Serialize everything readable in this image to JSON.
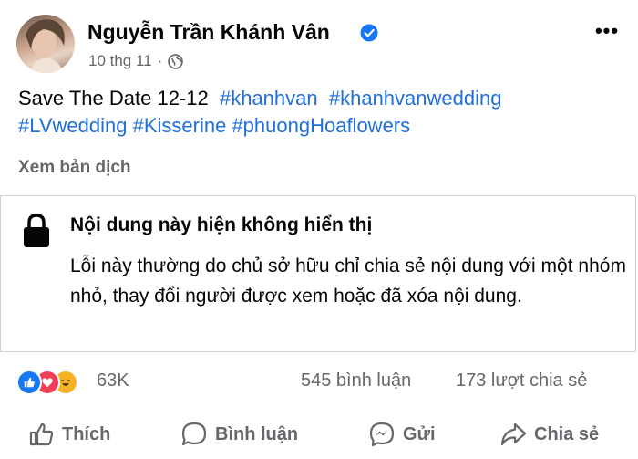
{
  "post": {
    "author": "Nguyễn Trần Khánh Vân",
    "date": "10 thg 11",
    "separator": "·",
    "more_label": "•••",
    "text_plain": "Save The Date 12-12",
    "hashtags": [
      "#khanhvan",
      "#khanhvanwedding",
      "#LVwedding",
      "#Kisserine",
      "#phuongHoaflowers"
    ],
    "translate_label": "Xem bản dịch"
  },
  "unavailable": {
    "title": "Nội dung này hiện không hiển thị",
    "body": "Lỗi này thường do chủ sở hữu chỉ chia sẻ nội dung với một nhóm nhỏ, thay đổi người được xem hoặc đã xóa nội dung."
  },
  "stats": {
    "reactions_count": "63K",
    "comments": "545 bình luận",
    "shares": "173 lượt chia sẻ"
  },
  "actions": {
    "like": "Thích",
    "comment": "Bình luận",
    "send": "Gửi",
    "share": "Chia sẻ"
  },
  "colors": {
    "hashtag": "#216fdb",
    "secondary_text": "#65676b",
    "like_blue": "#1877f2",
    "love_red": "#f33e58",
    "haha_yellow": "#f7b125"
  },
  "icons": {
    "verified": "verified-badge-icon",
    "privacy": "globe-icon",
    "lock": "lock-icon",
    "like": "thumbs-up-icon",
    "comment": "speech-bubble-icon",
    "send": "messenger-icon",
    "share": "share-arrow-icon"
  }
}
